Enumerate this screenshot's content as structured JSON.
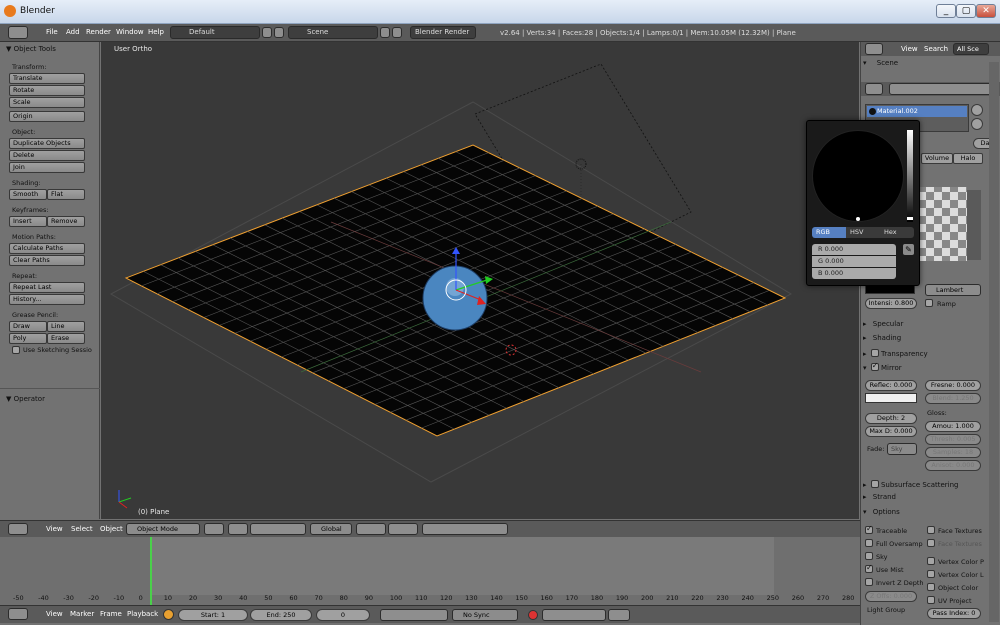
{
  "window": {
    "title": "Blender",
    "min": "_",
    "max": "▢",
    "close": "✕"
  },
  "menus": [
    "File",
    "Add",
    "Render",
    "Window",
    "Help"
  ],
  "layout_select": "Default",
  "scene_select": "Scene",
  "engine_select": "Blender Render",
  "stats": "v2.64 | Verts:34 | Faces:28 | Objects:1/4 | Lamps:0/1 | Mem:10.05M (12.32M) | Plane",
  "toolshelf": {
    "title": "Object Tools",
    "transform_label": "Transform:",
    "translate": "Translate",
    "rotate": "Rotate",
    "scale": "Scale",
    "origin": "Origin",
    "object_label": "Object:",
    "duplicate": "Duplicate Objects",
    "delete": "Delete",
    "join": "Join",
    "shading_label": "Shading:",
    "smooth": "Smooth",
    "flat": "Flat",
    "keyframes_label": "Keyframes:",
    "insert": "Insert",
    "remove": "Remove",
    "motion_label": "Motion Paths:",
    "calc_paths": "Calculate Paths",
    "clear_paths": "Clear Paths",
    "repeat_label": "Repeat:",
    "repeat_last": "Repeat Last",
    "history": "History...",
    "grease_label": "Grease Pencil:",
    "draw": "Draw",
    "line": "Line",
    "poly": "Poly",
    "erase": "Erase",
    "use_sketching": "Use Sketching Sessio",
    "operator": "Operator"
  },
  "viewport": {
    "view_label": "User Ortho",
    "object_label": "(0) Plane"
  },
  "header3d": {
    "view": "View",
    "select": "Select",
    "object": "Object",
    "mode": "Object Mode",
    "orientation": "Global"
  },
  "timeline": {
    "ticks": [
      "-50",
      "-40",
      "-30",
      "-20",
      "-10",
      "0",
      "10",
      "20",
      "30",
      "40",
      "50",
      "60",
      "70",
      "80",
      "90",
      "100",
      "110",
      "120",
      "130",
      "140",
      "150",
      "160",
      "170",
      "180",
      "190",
      "200",
      "210",
      "220",
      "230",
      "240",
      "250",
      "260",
      "270",
      "280"
    ],
    "view": "View",
    "marker": "Marker",
    "frame": "Frame",
    "playback": "Playback",
    "start": "Start: 1",
    "end": "End: 250",
    "current": "0",
    "sync": "No Sync"
  },
  "properties": {
    "view": "View",
    "search": "Search",
    "all_scenes": "All Sce",
    "scene": "Scene",
    "material_name": "Material.002",
    "data_label": "Da",
    "tab_volume": "Volume",
    "tab_halo": "Halo",
    "diffuse_shader": "Lambert",
    "intensity": "Intensi: 0.800",
    "ramp": "Ramp",
    "specular": "Specular",
    "shading": "Shading",
    "transparency": "Transparency",
    "mirror": "Mirror",
    "reflect": "Reflec: 0.000",
    "fresnel": "Fresne: 0.000",
    "blend": "Blend: 1.250",
    "depth": "Depth: 2",
    "maxdist": "Max D: 0.000",
    "gloss_label": "Gloss:",
    "amount": "Amou: 1.000",
    "thresh": "Thresh: 0.005",
    "samples": "Samples: 18",
    "aniso": "Anisot: 0.000",
    "fade_label": "Fade:",
    "fade_to": "Sky",
    "sss": "Subsurface Scattering",
    "strand": "Strand",
    "options": "Options",
    "traceable": "Traceable",
    "full_oversampling": "Full Oversamp",
    "sky": "Sky",
    "use_mist": "Use Mist",
    "invert_z": "Invert Z Depth",
    "z_offset": "Z Offs: 0.000",
    "face_textures": "Face Textures",
    "face_textures_alpha": "Face Textures",
    "vertex_color_paint": "Vertex Color P",
    "vertex_color_light": "Vertex Color L",
    "object_color": "Object Color",
    "uv_project": "UV Project",
    "light_group": "Light Group",
    "pass_index": "Pass Index: 0"
  },
  "colorpicker": {
    "tab_rgb": "RGB",
    "tab_hsv": "HSV",
    "tab_hex": "Hex",
    "r": "R 0.000",
    "g": "G 0.000",
    "b": "B 0.000"
  },
  "colors": {
    "accent": "#5680c2",
    "selection": "#f0a030",
    "viewport_bg": "#393939"
  }
}
